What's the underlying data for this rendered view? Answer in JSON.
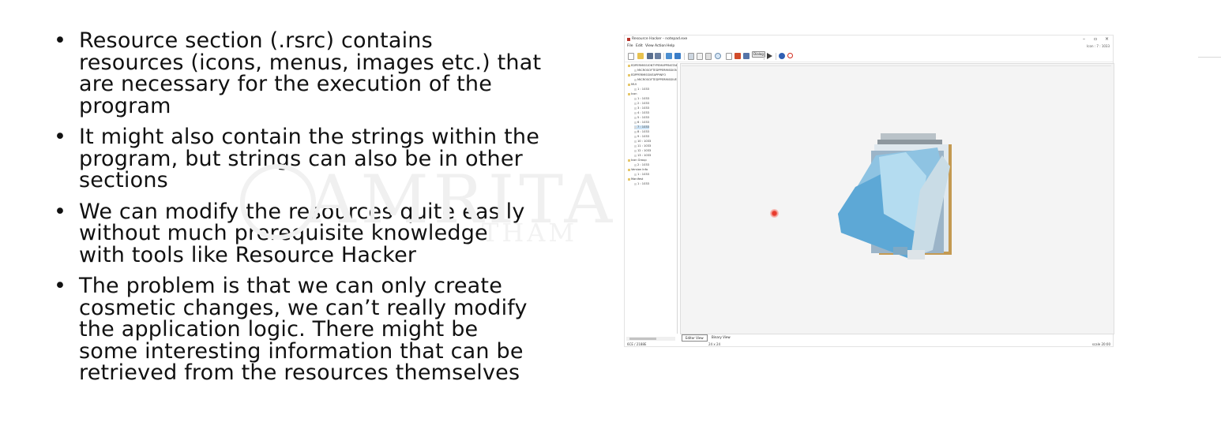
{
  "bullets": [
    {
      "text": "Resource section (.rsrc) contains\nresources (icons, menus, images etc.) that\nare necessary for the execution of the\nprogram"
    },
    {
      "text": "It might also contain the strings within the\nprogram, but strings can also be in other\nsections"
    },
    {
      "text": "We can modify the resources quite easily\nwithout much prerequisite knowledge\nwith tools like Resource Hacker"
    },
    {
      "text": "The problem is that we can only create\ncosmetic changes, we can’t really modify\nthe application logic. There might be\nsome interesting information that can be\nretrieved from the resources themselves"
    }
  ],
  "watermark": {
    "main": "AMRITA",
    "sub": "THAM"
  },
  "window": {
    "title": "Resource Hacker - notepad.exe",
    "menu": [
      "File",
      "Edit",
      "View",
      "Action",
      "Help"
    ],
    "status_right": "Icon : 7 : 1033",
    "controls": {
      "minimize": "–",
      "maximize": "▫",
      "close": "×"
    },
    "toolbar_dialog_label": "Dialog",
    "tree": [
      {
        "label": "EDPERMISSIONTYPEMAPPINGTABLE",
        "level": 0,
        "kind": "folder"
      },
      {
        "label": "MICROSOFTEDPPERMISSIONTYPE",
        "level": 1,
        "kind": "leaf"
      },
      {
        "label": "EDPPERMISSIVEAPPINFO",
        "level": 0,
        "kind": "folder"
      },
      {
        "label": "MICROSOFTEDPPERMISSIVEAPPINFO",
        "level": 1,
        "kind": "leaf"
      },
      {
        "label": "MUI",
        "level": 0,
        "kind": "folder"
      },
      {
        "label": "1 : 1033",
        "level": 1,
        "kind": "leaf"
      },
      {
        "label": "Icon",
        "level": 0,
        "kind": "folder"
      },
      {
        "label": "1 : 1033",
        "level": 1,
        "kind": "leaf"
      },
      {
        "label": "2 : 1033",
        "level": 1,
        "kind": "leaf"
      },
      {
        "label": "3 : 1033",
        "level": 1,
        "kind": "leaf"
      },
      {
        "label": "4 : 1033",
        "level": 1,
        "kind": "leaf"
      },
      {
        "label": "5 : 1033",
        "level": 1,
        "kind": "leaf"
      },
      {
        "label": "6 : 1033",
        "level": 1,
        "kind": "leaf"
      },
      {
        "label": "7 : 1033",
        "level": 1,
        "kind": "leaf",
        "selected": true
      },
      {
        "label": "8 : 1033",
        "level": 1,
        "kind": "leaf"
      },
      {
        "label": "9 : 1033",
        "level": 1,
        "kind": "leaf"
      },
      {
        "label": "10 : 1033",
        "level": 1,
        "kind": "leaf"
      },
      {
        "label": "11 : 1033",
        "level": 1,
        "kind": "leaf"
      },
      {
        "label": "12 : 1033",
        "level": 1,
        "kind": "leaf"
      },
      {
        "label": "13 : 1033",
        "level": 1,
        "kind": "leaf"
      },
      {
        "label": "Icon Group",
        "level": 0,
        "kind": "folder"
      },
      {
        "label": "2 : 1033",
        "level": 1,
        "kind": "leaf"
      },
      {
        "label": "Version Info",
        "level": 0,
        "kind": "folder"
      },
      {
        "label": "1 : 1033",
        "level": 1,
        "kind": "leaf"
      },
      {
        "label": "Manifest",
        "level": 0,
        "kind": "folder"
      },
      {
        "label": "1 : 1033",
        "level": 1,
        "kind": "leaf"
      }
    ],
    "tabs": [
      {
        "label": "Editor View",
        "active": true
      },
      {
        "label": "Binary View",
        "active": false
      }
    ],
    "status": {
      "left": "6CE / 2188E",
      "size": "24 x 24",
      "scale": "scale 20:00"
    }
  }
}
